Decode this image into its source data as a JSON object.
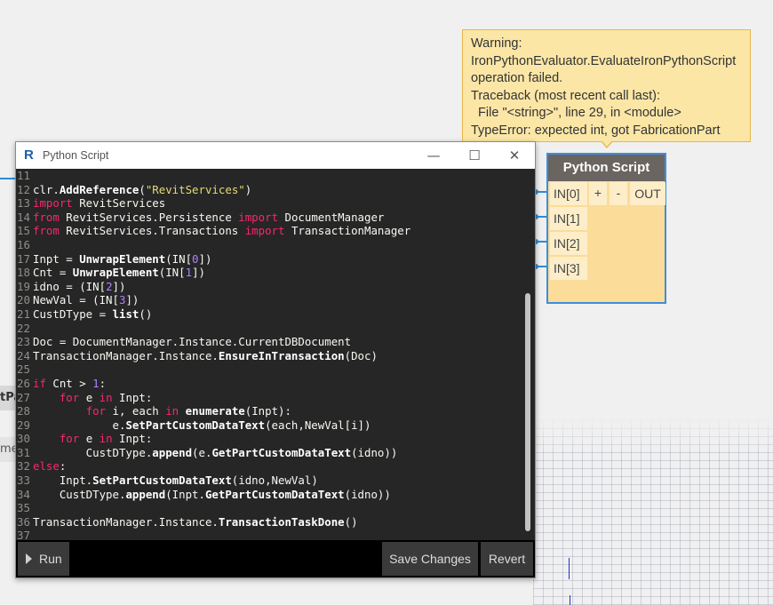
{
  "warning": {
    "lines": [
      "Warning:",
      "IronPythonEvaluator.EvaluateIronPythonScript",
      "operation failed.",
      "Traceback (most recent call last):",
      "  File \"<string>\", line 29, in <module>",
      "TypeError: expected int, got FabricationPart"
    ]
  },
  "node": {
    "title": "Python Script",
    "inputs": [
      "IN[0]",
      "IN[1]",
      "IN[2]",
      "IN[3]"
    ],
    "add_label": "+",
    "remove_label": "-",
    "output": "OUT"
  },
  "left_nodes": {
    "node1_text": "tPa",
    "node2_text": "me"
  },
  "editor": {
    "title": "Python Script",
    "logo": "R",
    "minimize_icon": "—",
    "maximize_icon": "☐",
    "close_icon": "✕",
    "run_label": "Run",
    "save_label": "Save Changes",
    "revert_label": "Revert",
    "code": [
      {
        "n": "11",
        "t": []
      },
      {
        "n": "12",
        "t": [
          [
            "",
            "clr."
          ],
          [
            "fn",
            "AddReference"
          ],
          [
            "",
            "("
          ],
          [
            "str",
            "\"RevitServices\""
          ],
          [
            "",
            ")"
          ]
        ]
      },
      {
        "n": "13",
        "t": [
          [
            "kw",
            "import"
          ],
          [
            "",
            " RevitServices"
          ]
        ]
      },
      {
        "n": "14",
        "t": [
          [
            "kw",
            "from"
          ],
          [
            "",
            " RevitServices.Persistence "
          ],
          [
            "kw",
            "import"
          ],
          [
            "",
            " DocumentManager"
          ]
        ]
      },
      {
        "n": "15",
        "t": [
          [
            "kw",
            "from"
          ],
          [
            "",
            " RevitServices.Transactions "
          ],
          [
            "kw",
            "import"
          ],
          [
            "",
            " TransactionManager"
          ]
        ]
      },
      {
        "n": "16",
        "t": []
      },
      {
        "n": "17",
        "t": [
          [
            "",
            "Inpt = "
          ],
          [
            "fn",
            "UnwrapElement"
          ],
          [
            "",
            "(IN["
          ],
          [
            "num",
            "0"
          ],
          [
            "",
            "])"
          ]
        ]
      },
      {
        "n": "18",
        "t": [
          [
            "",
            "Cnt = "
          ],
          [
            "fn",
            "UnwrapElement"
          ],
          [
            "",
            "(IN["
          ],
          [
            "num",
            "1"
          ],
          [
            "",
            "])"
          ]
        ]
      },
      {
        "n": "19",
        "t": [
          [
            "",
            "idno = (IN["
          ],
          [
            "num",
            "2"
          ],
          [
            "",
            "])"
          ]
        ]
      },
      {
        "n": "20",
        "t": [
          [
            "",
            "NewVal = (IN["
          ],
          [
            "num",
            "3"
          ],
          [
            "",
            "])"
          ]
        ]
      },
      {
        "n": "21",
        "t": [
          [
            "",
            "CustDType = "
          ],
          [
            "fn",
            "list"
          ],
          [
            "",
            "()"
          ]
        ]
      },
      {
        "n": "22",
        "t": []
      },
      {
        "n": "23",
        "t": [
          [
            "",
            "Doc = DocumentManager.Instance.CurrentDBDocument"
          ]
        ]
      },
      {
        "n": "24",
        "t": [
          [
            "",
            "TransactionManager.Instance."
          ],
          [
            "fn",
            "EnsureInTransaction"
          ],
          [
            "",
            "(Doc)"
          ]
        ]
      },
      {
        "n": "25",
        "t": []
      },
      {
        "n": "26",
        "t": [
          [
            "kw",
            "if"
          ],
          [
            "",
            " Cnt > "
          ],
          [
            "num",
            "1"
          ],
          [
            "",
            ":"
          ]
        ]
      },
      {
        "n": "27",
        "t": [
          [
            "",
            "    "
          ],
          [
            "kw",
            "for"
          ],
          [
            "",
            " e "
          ],
          [
            "kw",
            "in"
          ],
          [
            "",
            " Inpt:"
          ]
        ]
      },
      {
        "n": "28",
        "t": [
          [
            "",
            "        "
          ],
          [
            "kw",
            "for"
          ],
          [
            "",
            " i, each "
          ],
          [
            "kw",
            "in"
          ],
          [
            "",
            " "
          ],
          [
            "fn",
            "enumerate"
          ],
          [
            "",
            "(Inpt):"
          ]
        ]
      },
      {
        "n": "29",
        "t": [
          [
            "",
            "            e."
          ],
          [
            "fn",
            "SetPartCustomDataText"
          ],
          [
            "",
            "(each,NewVal[i])"
          ]
        ]
      },
      {
        "n": "30",
        "t": [
          [
            "",
            "    "
          ],
          [
            "kw",
            "for"
          ],
          [
            "",
            " e "
          ],
          [
            "kw",
            "in"
          ],
          [
            "",
            " Inpt:"
          ]
        ]
      },
      {
        "n": "31",
        "t": [
          [
            "",
            "        CustDType."
          ],
          [
            "fn",
            "append"
          ],
          [
            "",
            "(e."
          ],
          [
            "fn",
            "GetPartCustomDataText"
          ],
          [
            "",
            "(idno))"
          ]
        ]
      },
      {
        "n": "32",
        "t": [
          [
            "kw",
            "else"
          ],
          [
            "",
            ":"
          ]
        ]
      },
      {
        "n": "33",
        "t": [
          [
            "",
            "    Inpt."
          ],
          [
            "fn",
            "SetPartCustomDataText"
          ],
          [
            "",
            "(idno,NewVal)"
          ]
        ]
      },
      {
        "n": "34",
        "t": [
          [
            "",
            "    CustDType."
          ],
          [
            "fn",
            "append"
          ],
          [
            "",
            "(Inpt."
          ],
          [
            "fn",
            "GetPartCustomDataText"
          ],
          [
            "",
            "(idno))"
          ]
        ]
      },
      {
        "n": "35",
        "t": []
      },
      {
        "n": "36",
        "t": [
          [
            "",
            "TransactionManager.Instance."
          ],
          [
            "fn",
            "TransactionTaskDone"
          ],
          [
            "",
            "()"
          ]
        ]
      },
      {
        "n": "37",
        "t": []
      }
    ]
  }
}
